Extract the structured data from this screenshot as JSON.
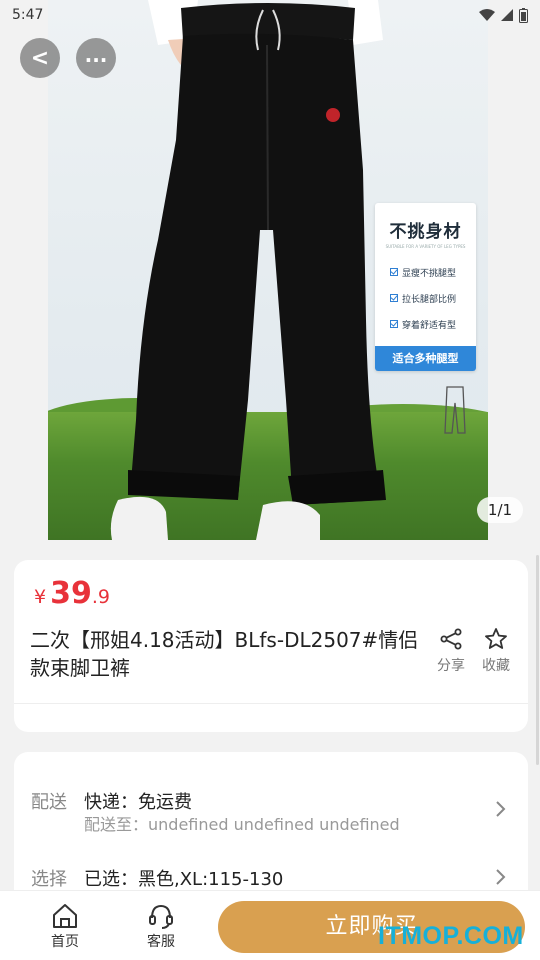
{
  "status_bar": {
    "time": "5:47"
  },
  "hero": {
    "pager": "1/1",
    "feature_card": {
      "title": "不挑身材",
      "subtitle": "SUITABLE FOR A VARIETY OF LEG TYPES",
      "items": [
        "显瘦不挑腿型",
        "拉长腿部比例",
        "穿着舒适有型"
      ],
      "footer": "适合多种腿型"
    }
  },
  "nav": {
    "back_label": "<",
    "more_label": "..."
  },
  "product": {
    "price_symbol": "¥",
    "price_int": "39",
    "price_dec": ".9",
    "title": "二次【邢姐4.18活动】BLfs-DL2507#情侣款束脚卫裤",
    "share_label": "分享",
    "favorite_label": "收藏"
  },
  "shipping": {
    "delivery_label": "配送",
    "delivery_value": "快递：免运费",
    "delivery_to": "配送至：undefined undefined undefined",
    "select_label": "选择",
    "select_value": "已选：黑色,XL:115-130"
  },
  "bottom_bar": {
    "home_label": "首页",
    "service_label": "客服",
    "buy_label": "立即购买"
  },
  "watermark": "ITMOP.COM",
  "colors": {
    "price": "#e8323a",
    "buy_button": "#d9a050",
    "watermark": "#17b0d8"
  }
}
